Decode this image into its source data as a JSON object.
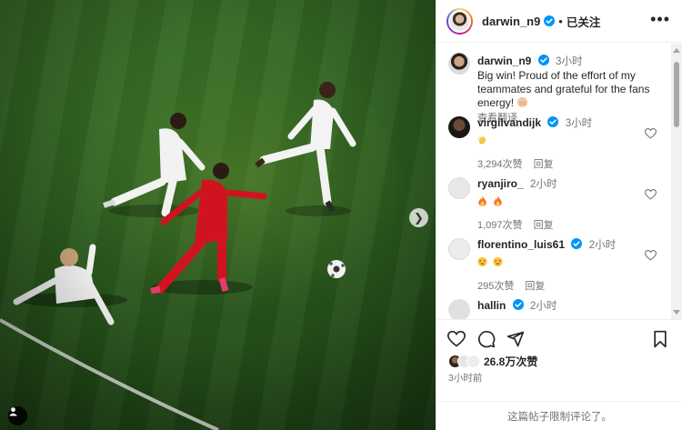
{
  "post": {
    "username": "darwin_n9",
    "follow_status": "已关注",
    "caption": "Big win! Proud of the effort of my teammates and grateful for the fans energy!",
    "caption_time": "3小时",
    "translate_label": "查看翻译"
  },
  "comments": [
    {
      "username": "virgilvandijk",
      "verified": true,
      "time": "3小时",
      "emoji": "clap",
      "likes": "3,294次赞",
      "reply_label": "回复",
      "avatar_color": "#2a2420"
    },
    {
      "username": "ryanjiro_",
      "verified": false,
      "time": "2小时",
      "emoji": "fire-fire",
      "likes": "1,097次赞",
      "reply_label": "回复",
      "avatar_color": "#e8e8e8"
    },
    {
      "username": "florentino_luis61",
      "verified": true,
      "time": "2小时",
      "emoji": "star-struck-2",
      "likes": "295次赞",
      "reply_label": "回复",
      "avatar_color": "#ececec"
    },
    {
      "username": "hallin",
      "verified": true,
      "time": "2小时",
      "emoji": "",
      "likes": "",
      "reply_label": "",
      "avatar_color": "#e0e0e0"
    }
  ],
  "engagement": {
    "likes_count": "26.8万次赞",
    "post_time": "3小时前",
    "comments_restricted": "这篇帖子限制评论了。"
  },
  "colors": {
    "verified": "#0095f6",
    "pitch": "#2c5c1e",
    "liverpool_red": "#d0141f"
  },
  "icons": {
    "like": "heart-icon",
    "comment": "comment-icon",
    "share": "share-icon",
    "save": "bookmark-icon",
    "more": "more-icon",
    "next": "chevron-right-icon",
    "tag": "user-tag-icon"
  }
}
